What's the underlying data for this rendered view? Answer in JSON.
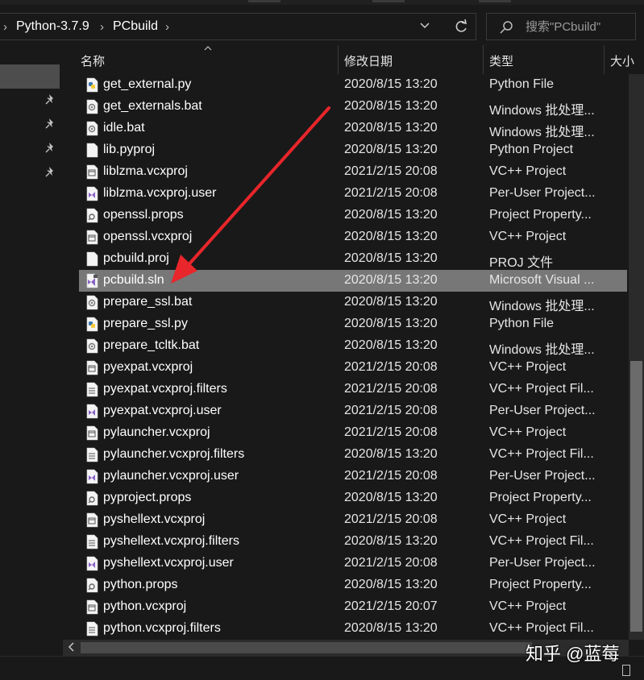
{
  "breadcrumb": {
    "items": [
      "Python-3.7.9",
      "PCbuild"
    ],
    "separator": "›"
  },
  "search": {
    "placeholder": "搜索\"PCbuild\""
  },
  "columns": {
    "name": "名称",
    "date": "修改日期",
    "type": "类型",
    "size": "大小"
  },
  "files": [
    {
      "name": "get_external.py",
      "date": "2020/8/15 13:20",
      "type": "Python File",
      "icon": "python-file-icon"
    },
    {
      "name": "get_externals.bat",
      "date": "2020/8/15 13:20",
      "type": "Windows 批处理...",
      "icon": "batch-file-icon"
    },
    {
      "name": "idle.bat",
      "date": "2020/8/15 13:20",
      "type": "Windows 批处理...",
      "icon": "batch-file-icon"
    },
    {
      "name": "lib.pyproj",
      "date": "2020/8/15 13:20",
      "type": "Python Project",
      "icon": "blank-file-icon"
    },
    {
      "name": "liblzma.vcxproj",
      "date": "2021/2/15 20:08",
      "type": "VC++ Project",
      "icon": "vcxproj-file-icon"
    },
    {
      "name": "liblzma.vcxproj.user",
      "date": "2021/2/15 20:08",
      "type": "Per-User Project...",
      "icon": "vs-user-file-icon"
    },
    {
      "name": "openssl.props",
      "date": "2020/8/15 13:20",
      "type": "Project Property...",
      "icon": "props-file-icon"
    },
    {
      "name": "openssl.vcxproj",
      "date": "2020/8/15 13:20",
      "type": "VC++ Project",
      "icon": "vcxproj-file-icon"
    },
    {
      "name": "pcbuild.proj",
      "date": "2020/8/15 13:20",
      "type": "PROJ 文件",
      "icon": "blank-file-icon"
    },
    {
      "name": "pcbuild.sln",
      "date": "2020/8/15 13:20",
      "type": "Microsoft Visual ...",
      "icon": "vs-solution-file-icon",
      "selected": true
    },
    {
      "name": "prepare_ssl.bat",
      "date": "2020/8/15 13:20",
      "type": "Windows 批处理...",
      "icon": "batch-file-icon"
    },
    {
      "name": "prepare_ssl.py",
      "date": "2020/8/15 13:20",
      "type": "Python File",
      "icon": "python-file-icon"
    },
    {
      "name": "prepare_tcltk.bat",
      "date": "2020/8/15 13:20",
      "type": "Windows 批处理...",
      "icon": "batch-file-icon"
    },
    {
      "name": "pyexpat.vcxproj",
      "date": "2021/2/15 20:08",
      "type": "VC++ Project",
      "icon": "vcxproj-file-icon"
    },
    {
      "name": "pyexpat.vcxproj.filters",
      "date": "2021/2/15 20:08",
      "type": "VC++ Project Fil...",
      "icon": "filters-file-icon"
    },
    {
      "name": "pyexpat.vcxproj.user",
      "date": "2021/2/15 20:08",
      "type": "Per-User Project...",
      "icon": "vs-user-file-icon"
    },
    {
      "name": "pylauncher.vcxproj",
      "date": "2021/2/15 20:08",
      "type": "VC++ Project",
      "icon": "vcxproj-file-icon"
    },
    {
      "name": "pylauncher.vcxproj.filters",
      "date": "2020/8/15 13:20",
      "type": "VC++ Project Fil...",
      "icon": "filters-file-icon"
    },
    {
      "name": "pylauncher.vcxproj.user",
      "date": "2021/2/15 20:08",
      "type": "Per-User Project...",
      "icon": "vs-user-file-icon"
    },
    {
      "name": "pyproject.props",
      "date": "2020/8/15 13:20",
      "type": "Project Property...",
      "icon": "props-file-icon"
    },
    {
      "name": "pyshellext.vcxproj",
      "date": "2021/2/15 20:08",
      "type": "VC++ Project",
      "icon": "vcxproj-file-icon"
    },
    {
      "name": "pyshellext.vcxproj.filters",
      "date": "2020/8/15 13:20",
      "type": "VC++ Project Fil...",
      "icon": "filters-file-icon"
    },
    {
      "name": "pyshellext.vcxproj.user",
      "date": "2021/2/15 20:08",
      "type": "Per-User Project...",
      "icon": "vs-user-file-icon"
    },
    {
      "name": "python.props",
      "date": "2020/8/15 13:20",
      "type": "Project Property...",
      "icon": "props-file-icon"
    },
    {
      "name": "python.vcxproj",
      "date": "2021/2/15 20:07",
      "type": "VC++ Project",
      "icon": "vcxproj-file-icon"
    },
    {
      "name": "python.vcxproj.filters",
      "date": "2020/8/15 13:20",
      "type": "VC++ Project Fil...",
      "icon": "filters-file-icon"
    }
  ],
  "watermark": "知乎 @蓝莓",
  "colors": {
    "background": "#191919",
    "selected_row": "#777777",
    "annotation_arrow": "#e8262b",
    "vs_purple": "#8a63c9",
    "python_blue": "#3a75b0",
    "python_yellow": "#f5cb3b"
  },
  "nav": {
    "pinned_count": 4
  }
}
